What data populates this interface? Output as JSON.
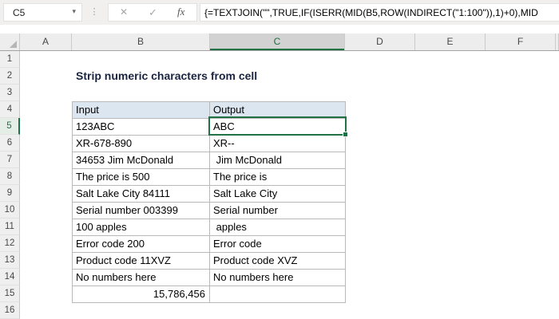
{
  "colors": {
    "accent": "#217346",
    "header_fill": "#DCE6F1",
    "title_color": "#1A2440"
  },
  "formula_bar": {
    "name_box": "C5",
    "formula": "{=TEXTJOIN(\"\",TRUE,IF(ISERR(MID(B5,ROW(INDIRECT(\"1:100\")),1)+0),MID",
    "icons": {
      "dropdown": "▾",
      "ellipsis": "⋮",
      "cancel": "✕",
      "enter": "✓",
      "fx": "fx"
    }
  },
  "sheet": {
    "title": "Strip numeric characters from cell",
    "column_headers": [
      "A",
      "B",
      "C",
      "D",
      "E",
      "F"
    ],
    "selected_column": "C",
    "row_headers": [
      "1",
      "2",
      "3",
      "4",
      "5",
      "6",
      "7",
      "8",
      "9",
      "10",
      "11",
      "12",
      "13",
      "14",
      "15",
      "16"
    ],
    "selected_row": "5",
    "selected_cell": "C5",
    "table": {
      "headers": [
        "Input",
        "Output"
      ],
      "rows": [
        {
          "input": "123ABC",
          "output": "ABC",
          "align": "left"
        },
        {
          "input": "XR-678-890",
          "output": "XR--",
          "align": "left"
        },
        {
          "input": "34653 Jim McDonald",
          "output": " Jim McDonald",
          "align": "left"
        },
        {
          "input": "The price is 500",
          "output": "The price is ",
          "align": "left"
        },
        {
          "input": "Salt Lake City 84111",
          "output": "Salt Lake City",
          "align": "left"
        },
        {
          "input": "Serial number 003399",
          "output": "Serial number",
          "align": "left"
        },
        {
          "input": "100 apples",
          "output": " apples",
          "align": "left"
        },
        {
          "input": "Error code 200",
          "output": "Error code",
          "align": "left"
        },
        {
          "input": "Product code 11XVZ",
          "output": "Product code XVZ",
          "align": "left"
        },
        {
          "input": "No numbers here",
          "output": "No numbers here",
          "align": "left"
        },
        {
          "input": "15,786,456",
          "output": "",
          "align": "right"
        }
      ]
    }
  }
}
